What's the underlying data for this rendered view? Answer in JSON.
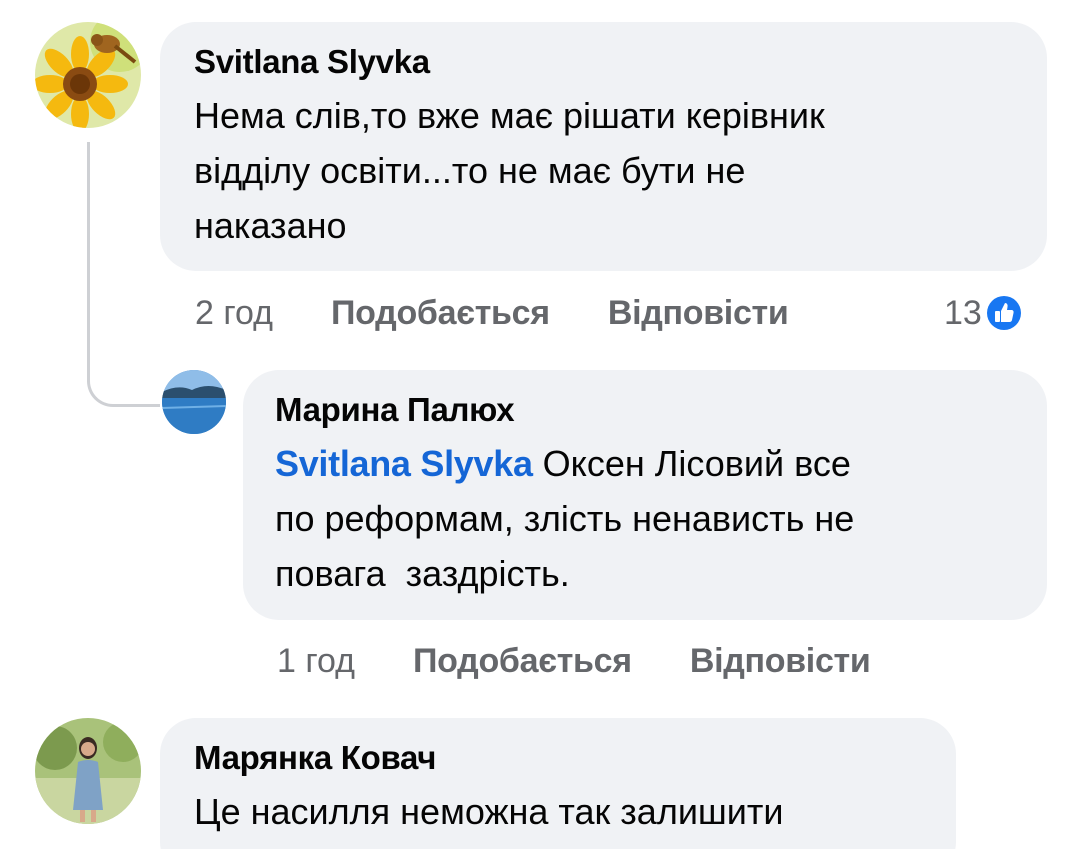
{
  "comments": [
    {
      "author": "Svitlana Slyvka",
      "text": "Нема слів,то вже має рішати керівник\nвідділу освіти...то не має бути не\nнаказано",
      "time": "2 год",
      "like_label": "Подобається",
      "reply_label": "Відповісти",
      "reaction_count": "13",
      "avatar_icon": "sunflower-bird-avatar"
    },
    {
      "author": "Марина Палюх",
      "mention": "Svitlana Slyvka",
      "text": " Оксен Лісовий все\nпо реформам, злість ненависть не\nповага  заздрість.",
      "time": "1 год",
      "like_label": "Подобається",
      "reply_label": "Відповісти",
      "avatar_icon": "lake-landscape-avatar"
    },
    {
      "author": "Марянка Ковач",
      "text": "Це насилля неможна так залишити",
      "avatar_icon": "woman-portrait-avatar"
    }
  ],
  "colors": {
    "bubble": "#f0f2f5",
    "mention": "#1566d6",
    "like_blue": "#1877f2",
    "meta_gray": "#65676b"
  }
}
